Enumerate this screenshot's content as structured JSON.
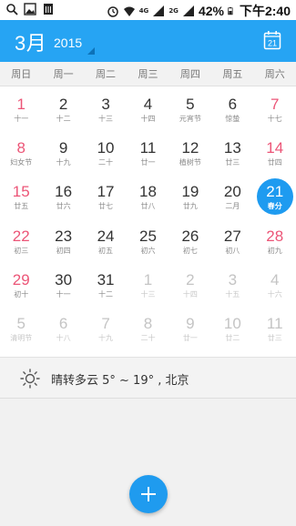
{
  "status_bar": {
    "network_label": "4G",
    "network_label2": "2G",
    "battery": "42%",
    "time": "下午2:40",
    "icons": [
      "search-icon",
      "image-icon",
      "sim-icon",
      "alarm-icon",
      "wifi-icon",
      "signal-icon",
      "battery-icon"
    ]
  },
  "header": {
    "month": "3月",
    "year": "2015",
    "today_button": "21",
    "colors": {
      "background": "#26a4f3",
      "accent": "#1e9bf0",
      "weekend": "#ec5577"
    }
  },
  "weekdays": [
    "周日",
    "周一",
    "周二",
    "周三",
    "周四",
    "周五",
    "周六"
  ],
  "weeks": [
    [
      {
        "day": "1",
        "lunar": "十一",
        "weekend": true
      },
      {
        "day": "2",
        "lunar": "十二"
      },
      {
        "day": "3",
        "lunar": "十三"
      },
      {
        "day": "4",
        "lunar": "十四"
      },
      {
        "day": "5",
        "lunar": "元宵节"
      },
      {
        "day": "6",
        "lunar": "惊蛰"
      },
      {
        "day": "7",
        "lunar": "十七",
        "weekend": true
      }
    ],
    [
      {
        "day": "8",
        "lunar": "妇女节",
        "weekend": true
      },
      {
        "day": "9",
        "lunar": "十九"
      },
      {
        "day": "10",
        "lunar": "二十"
      },
      {
        "day": "11",
        "lunar": "廿一"
      },
      {
        "day": "12",
        "lunar": "植树节"
      },
      {
        "day": "13",
        "lunar": "廿三"
      },
      {
        "day": "14",
        "lunar": "廿四",
        "weekend": true
      }
    ],
    [
      {
        "day": "15",
        "lunar": "廿五",
        "weekend": true
      },
      {
        "day": "16",
        "lunar": "廿六"
      },
      {
        "day": "17",
        "lunar": "廿七"
      },
      {
        "day": "18",
        "lunar": "廿八"
      },
      {
        "day": "19",
        "lunar": "廿九"
      },
      {
        "day": "20",
        "lunar": "二月"
      },
      {
        "day": "21",
        "lunar": "春分",
        "today": true
      }
    ],
    [
      {
        "day": "22",
        "lunar": "初三",
        "weekend": true
      },
      {
        "day": "23",
        "lunar": "初四"
      },
      {
        "day": "24",
        "lunar": "初五"
      },
      {
        "day": "25",
        "lunar": "初六"
      },
      {
        "day": "26",
        "lunar": "初七"
      },
      {
        "day": "27",
        "lunar": "初八"
      },
      {
        "day": "28",
        "lunar": "初九",
        "weekend": true
      }
    ],
    [
      {
        "day": "29",
        "lunar": "初十",
        "weekend": true
      },
      {
        "day": "30",
        "lunar": "十一"
      },
      {
        "day": "31",
        "lunar": "十二"
      },
      {
        "day": "1",
        "lunar": "十三",
        "other": true
      },
      {
        "day": "2",
        "lunar": "十四",
        "other": true
      },
      {
        "day": "3",
        "lunar": "十五",
        "other": true
      },
      {
        "day": "4",
        "lunar": "十六",
        "other": true
      }
    ],
    [
      {
        "day": "5",
        "lunar": "清明节",
        "other": true
      },
      {
        "day": "6",
        "lunar": "十八",
        "other": true
      },
      {
        "day": "7",
        "lunar": "十九",
        "other": true
      },
      {
        "day": "8",
        "lunar": "二十",
        "other": true
      },
      {
        "day": "9",
        "lunar": "廿一",
        "other": true
      },
      {
        "day": "10",
        "lunar": "廿二",
        "other": true
      },
      {
        "day": "11",
        "lunar": "廿三",
        "other": true
      }
    ]
  ],
  "weather": {
    "icon": "sun-icon",
    "text": "晴转多云  5° ~ 19° , 北京"
  },
  "fab": {
    "icon": "plus-icon"
  }
}
